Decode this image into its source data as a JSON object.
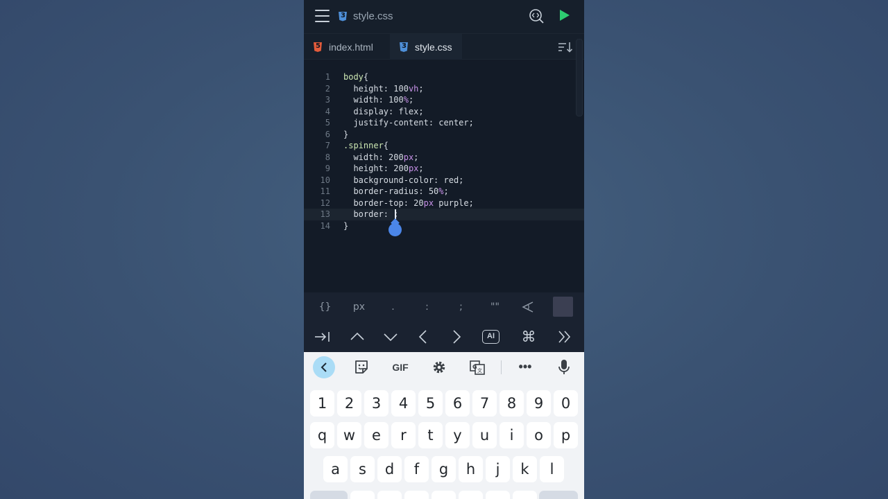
{
  "top_bar": {
    "file_name": "style.css",
    "icons": [
      "menu-icon",
      "css-file-icon",
      "preview-icon",
      "run-icon"
    ],
    "run_color": "#2ecc71"
  },
  "tabs": [
    {
      "label": "index.html",
      "icon": "html-file-icon",
      "active": false
    },
    {
      "label": "style.css",
      "icon": "css-file-icon",
      "active": true
    }
  ],
  "editor": {
    "current_line": 13,
    "lines": [
      {
        "n": "1",
        "text": "body{"
      },
      {
        "n": "2",
        "text": "  height: 100vh;"
      },
      {
        "n": "3",
        "text": "  width: 100%;"
      },
      {
        "n": "4",
        "text": "  display: flex;"
      },
      {
        "n": "5",
        "text": "  justify-content: center;"
      },
      {
        "n": "6",
        "text": "}"
      },
      {
        "n": "7",
        "text": ".spinner{"
      },
      {
        "n": "8",
        "text": "  width: 200px;"
      },
      {
        "n": "9",
        "text": "  height: 200px;"
      },
      {
        "n": "10",
        "text": "  background-color: red;"
      },
      {
        "n": "11",
        "text": "  border-radius: 50%;"
      },
      {
        "n": "12",
        "text": "  border-top: 20px purple;"
      },
      {
        "n": "13",
        "text": "  border: ;"
      },
      {
        "n": "14",
        "text": "}"
      }
    ]
  },
  "symbol_bar": {
    "keys": [
      "{}",
      "px",
      ".",
      ":",
      ";",
      "\"\""
    ],
    "extra_icons": [
      "angle-icon",
      "color-swatch"
    ]
  },
  "nav_bar": {
    "icons": [
      "tab-indent-icon",
      "caret-up-icon",
      "caret-down-icon",
      "caret-left-icon",
      "caret-right-icon",
      "ai-icon",
      "command-icon",
      "double-chevron-right-icon"
    ],
    "ai_label": "AI"
  },
  "keyboard": {
    "toolbar": {
      "gif_label": "GIF",
      "icons": [
        "back-icon",
        "sticker-icon",
        "gif-icon",
        "settings-icon",
        "translate-icon",
        "more-icon",
        "mic-icon"
      ]
    },
    "row_numbers": [
      "1",
      "2",
      "3",
      "4",
      "5",
      "6",
      "7",
      "8",
      "9",
      "0"
    ],
    "row_q": [
      "q",
      "w",
      "e",
      "r",
      "t",
      "y",
      "u",
      "i",
      "o",
      "p"
    ],
    "row_a": [
      "a",
      "s",
      "d",
      "f",
      "g",
      "h",
      "j",
      "k",
      "l"
    ]
  }
}
